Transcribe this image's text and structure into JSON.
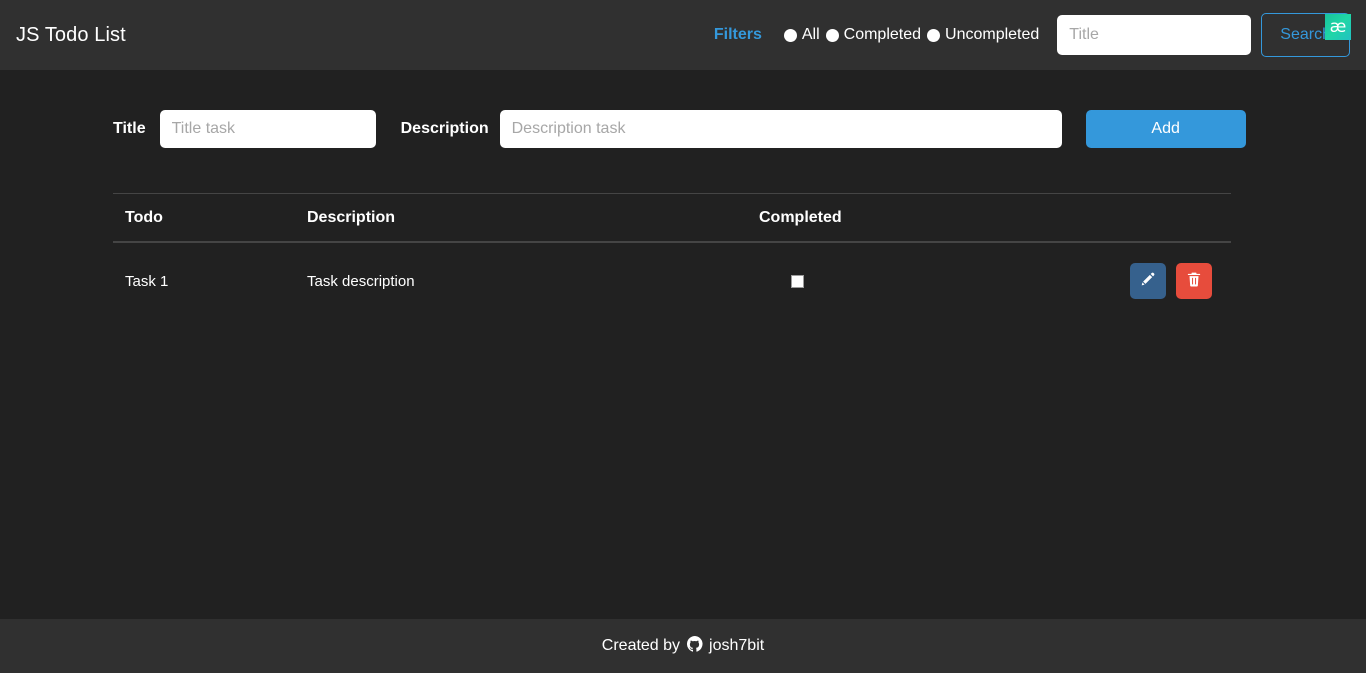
{
  "header": {
    "brand": "JS Todo List",
    "filters_label": "Filters",
    "filters": [
      {
        "label": "All",
        "name": "radio-filter-all"
      },
      {
        "label": "Completed",
        "name": "radio-filter-completed"
      },
      {
        "label": "Uncompleted",
        "name": "radio-filter-uncompleted"
      }
    ],
    "search": {
      "placeholder": "Title",
      "value": "",
      "button_label": "Search"
    },
    "extension_badge": "æ"
  },
  "form": {
    "title_label": "Title",
    "title_placeholder": "Title task",
    "title_value": "",
    "description_label": "Description",
    "description_placeholder": "Description task",
    "description_value": "",
    "add_label": "Add"
  },
  "table": {
    "columns": [
      "Todo",
      "Description",
      "Completed",
      ""
    ],
    "rows": [
      {
        "todo": "Task 1",
        "description": "Task description",
        "completed": false,
        "edit_label": "Edit",
        "delete_label": "Delete"
      }
    ]
  },
  "footer": {
    "created_by": "Created by",
    "author": "josh7bit"
  },
  "colors": {
    "background": "#212121",
    "surface": "#303030",
    "accent": "#3498db",
    "edit": "#36618d",
    "danger": "#e74c3c",
    "badge": "#1fd6a6"
  }
}
